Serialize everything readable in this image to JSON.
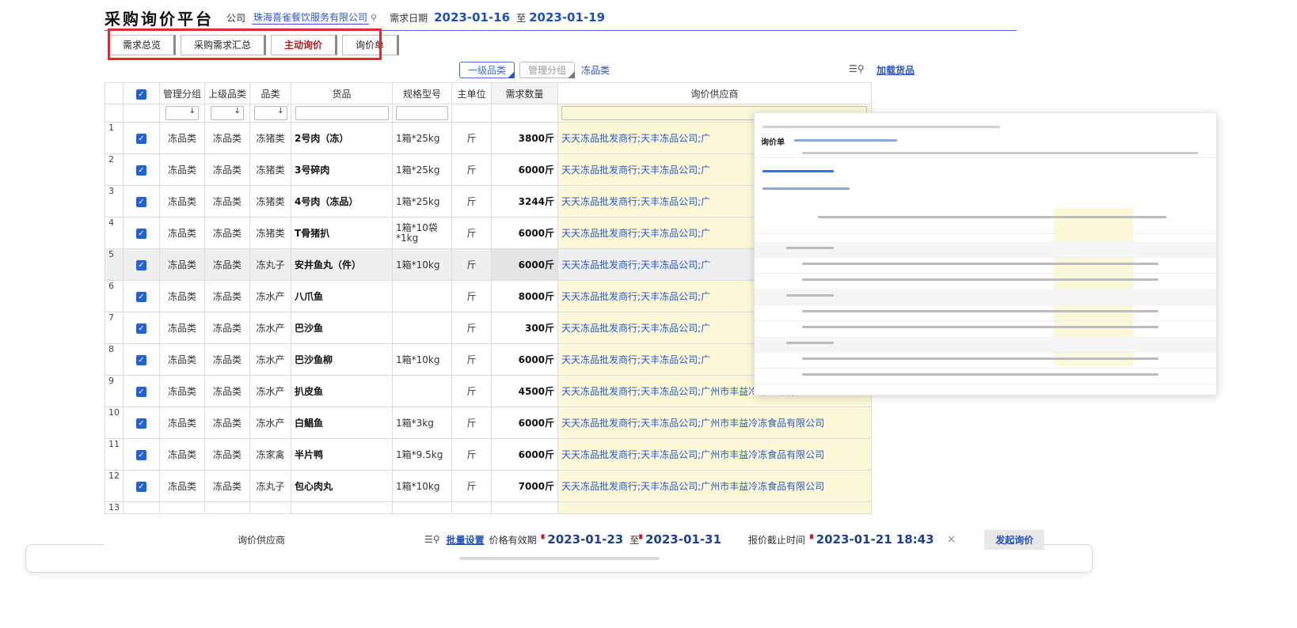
{
  "header": {
    "title": "采购询价平台",
    "company_label": "公司",
    "company_value": "珠海喜雀餐饮服务有限公司",
    "date_label": "需求日期",
    "date_from": "2023-01-16",
    "to_label": "至",
    "date_to": "2023-01-19"
  },
  "tabs": [
    {
      "label": "需求总览"
    },
    {
      "label": "采购需求汇总"
    },
    {
      "label": "主动询价",
      "active": true
    },
    {
      "label": "询价单"
    }
  ],
  "filters": {
    "level1": "一级品类",
    "group": "管理分组",
    "category": "冻品类",
    "load_label": "加载货品"
  },
  "columns": [
    "管理分组",
    "上级品类",
    "品类",
    "货品",
    "规格型号",
    "主单位",
    "需求数量",
    "询价供应商"
  ],
  "rows": [
    {
      "n": "1",
      "group": "冻品类",
      "parent": "冻品类",
      "cat": "冻猪类",
      "goods": "2号肉（冻）",
      "spec": "1箱*25kg",
      "unit": "斤",
      "qty": "3800斤",
      "sup": "天天冻品批发商行;天丰冻品公司;广"
    },
    {
      "n": "2",
      "group": "冻品类",
      "parent": "冻品类",
      "cat": "冻猪类",
      "goods": "3号碎肉",
      "spec": "1箱*25kg",
      "unit": "斤",
      "qty": "6000斤",
      "sup": "天天冻品批发商行;天丰冻品公司;广"
    },
    {
      "n": "3",
      "group": "冻品类",
      "parent": "冻品类",
      "cat": "冻猪类",
      "goods": "4号肉（冻品）",
      "spec": "1箱*25kg",
      "unit": "斤",
      "qty": "3244斤",
      "sup": "天天冻品批发商行;天丰冻品公司;广"
    },
    {
      "n": "4",
      "group": "冻品类",
      "parent": "冻品类",
      "cat": "冻猪类",
      "goods": "T骨猪扒",
      "spec": "1箱*10袋*1kg",
      "unit": "斤",
      "qty": "6000斤",
      "sup": "天天冻品批发商行;天丰冻品公司;广"
    },
    {
      "n": "5",
      "group": "冻品类",
      "parent": "冻品类",
      "cat": "冻丸子",
      "goods": "安井鱼丸（件）",
      "spec": "1箱*10kg",
      "unit": "斤",
      "qty": "6000斤",
      "sup": "天天冻品批发商行;天丰冻品公司;广",
      "selected": true
    },
    {
      "n": "6",
      "group": "冻品类",
      "parent": "冻品类",
      "cat": "冻水产",
      "goods": "八爪鱼",
      "spec": "",
      "unit": "斤",
      "qty": "8000斤",
      "sup": "天天冻品批发商行;天丰冻品公司;广"
    },
    {
      "n": "7",
      "group": "冻品类",
      "parent": "冻品类",
      "cat": "冻水产",
      "goods": "巴沙鱼",
      "spec": "",
      "unit": "斤",
      "qty": "300斤",
      "sup": "天天冻品批发商行;天丰冻品公司;广"
    },
    {
      "n": "8",
      "group": "冻品类",
      "parent": "冻品类",
      "cat": "冻水产",
      "goods": "巴沙鱼柳",
      "spec": "1箱*10kg",
      "unit": "斤",
      "qty": "6000斤",
      "sup": "天天冻品批发商行;天丰冻品公司;广"
    },
    {
      "n": "9",
      "group": "冻品类",
      "parent": "冻品类",
      "cat": "冻水产",
      "goods": "扒皮鱼",
      "spec": "",
      "unit": "斤",
      "qty": "4500斤",
      "sup": "天天冻品批发商行;天丰冻品公司;广州市丰益冷冻食品有限公司"
    },
    {
      "n": "10",
      "group": "冻品类",
      "parent": "冻品类",
      "cat": "冻水产",
      "goods": "白鲳鱼",
      "spec": "1箱*3kg",
      "unit": "斤",
      "qty": "6000斤",
      "sup": "天天冻品批发商行;天丰冻品公司;广州市丰益冷冻食品有限公司"
    },
    {
      "n": "11",
      "group": "冻品类",
      "parent": "冻品类",
      "cat": "冻家禽",
      "goods": "半片鸭",
      "spec": "1箱*9.5kg",
      "unit": "斤",
      "qty": "6000斤",
      "sup": "天天冻品批发商行;天丰冻品公司;广州市丰益冷冻食品有限公司"
    },
    {
      "n": "12",
      "group": "冻品类",
      "parent": "冻品类",
      "cat": "冻丸子",
      "goods": "包心肉丸",
      "spec": "1箱*10kg",
      "unit": "斤",
      "qty": "7000斤",
      "sup": "天天冻品批发商行;天丰冻品公司;广州市丰益冷冻食品有限公司"
    },
    {
      "n": "13",
      "group": "",
      "parent": "",
      "cat": "",
      "goods": "",
      "spec": "",
      "unit": "",
      "qty": "",
      "sup": ""
    }
  ],
  "footer": {
    "supplier_label": "询价供应商",
    "batch_label": "批量设置",
    "validity_label": "价格有效期",
    "valid_from": "2023-01-23",
    "to_label": "至",
    "valid_to": "2023-01-31",
    "deadline_label": "报价截止时间",
    "deadline": "2023-01-21 18:43",
    "close": "×",
    "launch_label": "发起询价"
  },
  "thumbnail": {
    "title": "询价单"
  }
}
